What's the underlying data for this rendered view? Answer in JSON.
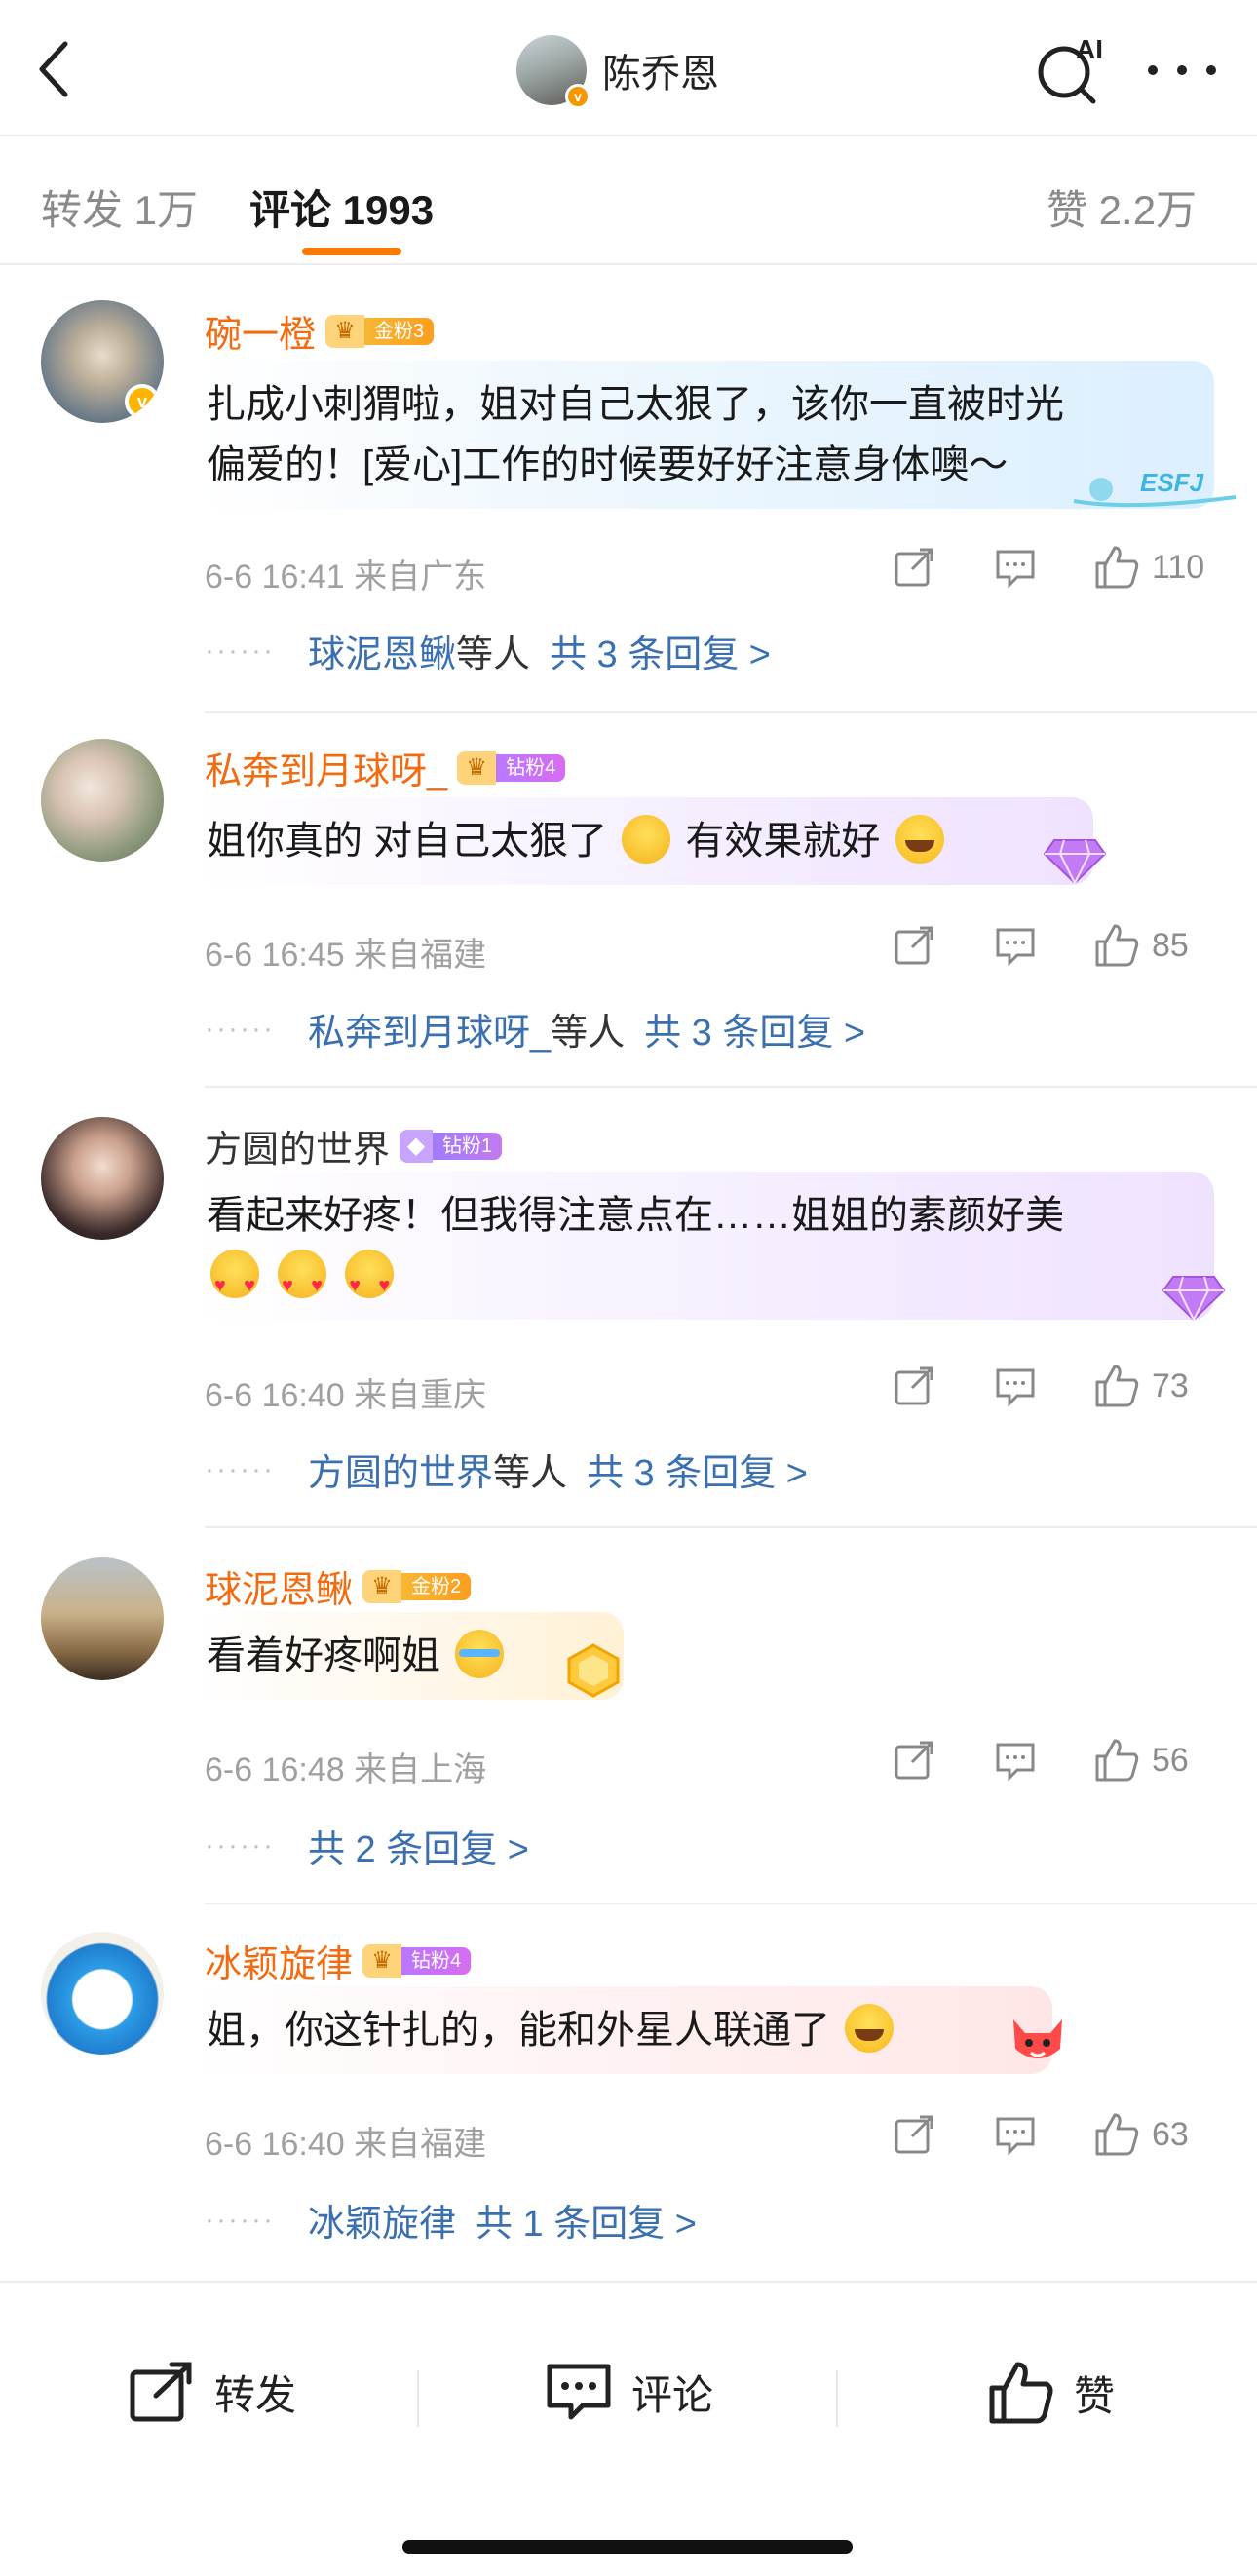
{
  "header": {
    "title": "陈乔恩",
    "ai_label": "AI"
  },
  "tabs": [
    {
      "label": "转发 1万"
    },
    {
      "label": "评论 1993"
    },
    {
      "label": "赞 2.2万"
    }
  ],
  "comments": [
    {
      "user": "碗一橙",
      "badge": "金粉3",
      "text_lines": [
        "扎成小刺猬啦，姐对自己太狠了，该你一直被时光",
        "偏爱的！[爱心]工作的时候要好好注意身体噢～"
      ],
      "time": "6-6 16:41 来自广东",
      "likes": "110",
      "reply_name": "球泥恩鳅",
      "reply_suffix": "等人",
      "reply_link": "共 3 条回复 >",
      "deco_text": "ESFJ"
    },
    {
      "user": "私奔到月球呀_",
      "badge": "钻粉4",
      "text_a": "姐你真的 对自己太狠了",
      "text_b": "有效果就好",
      "time": "6-6 16:45 来自福建",
      "likes": "85",
      "reply_name": "私奔到月球呀_",
      "reply_suffix": "等人",
      "reply_link": "共 3 条回复 >"
    },
    {
      "user": "方圆的世界",
      "badge": "钻粉1",
      "text_lines": [
        "看起来好疼！但我得注意点在……姐姐的素颜好美"
      ],
      "time": "6-6 16:40 来自重庆",
      "likes": "73",
      "reply_name": "方圆的世界",
      "reply_suffix": "等人",
      "reply_link": "共 3 条回复 >"
    },
    {
      "user": "球泥恩鳅",
      "badge": "金粉2",
      "text": "看着好疼啊姐",
      "time": "6-6 16:48 来自上海",
      "likes": "56",
      "reply_link": "共 2 条回复 >"
    },
    {
      "user": "冰颖旋律",
      "badge": "钻粉4",
      "text": "姐，你这针扎的，能和外星人联通了",
      "time": "6-6 16:40 来自福建",
      "likes": "63",
      "reply_name": "冰颖旋律",
      "reply_link": "共 1 条回复 >"
    }
  ],
  "bottom_bar": {
    "repost": "转发",
    "comment": "评论",
    "like": "赞"
  },
  "colors": {
    "accent": "#ff7a00",
    "username_orange": "#f26b10",
    "reply_link": "#3a6fb0"
  }
}
